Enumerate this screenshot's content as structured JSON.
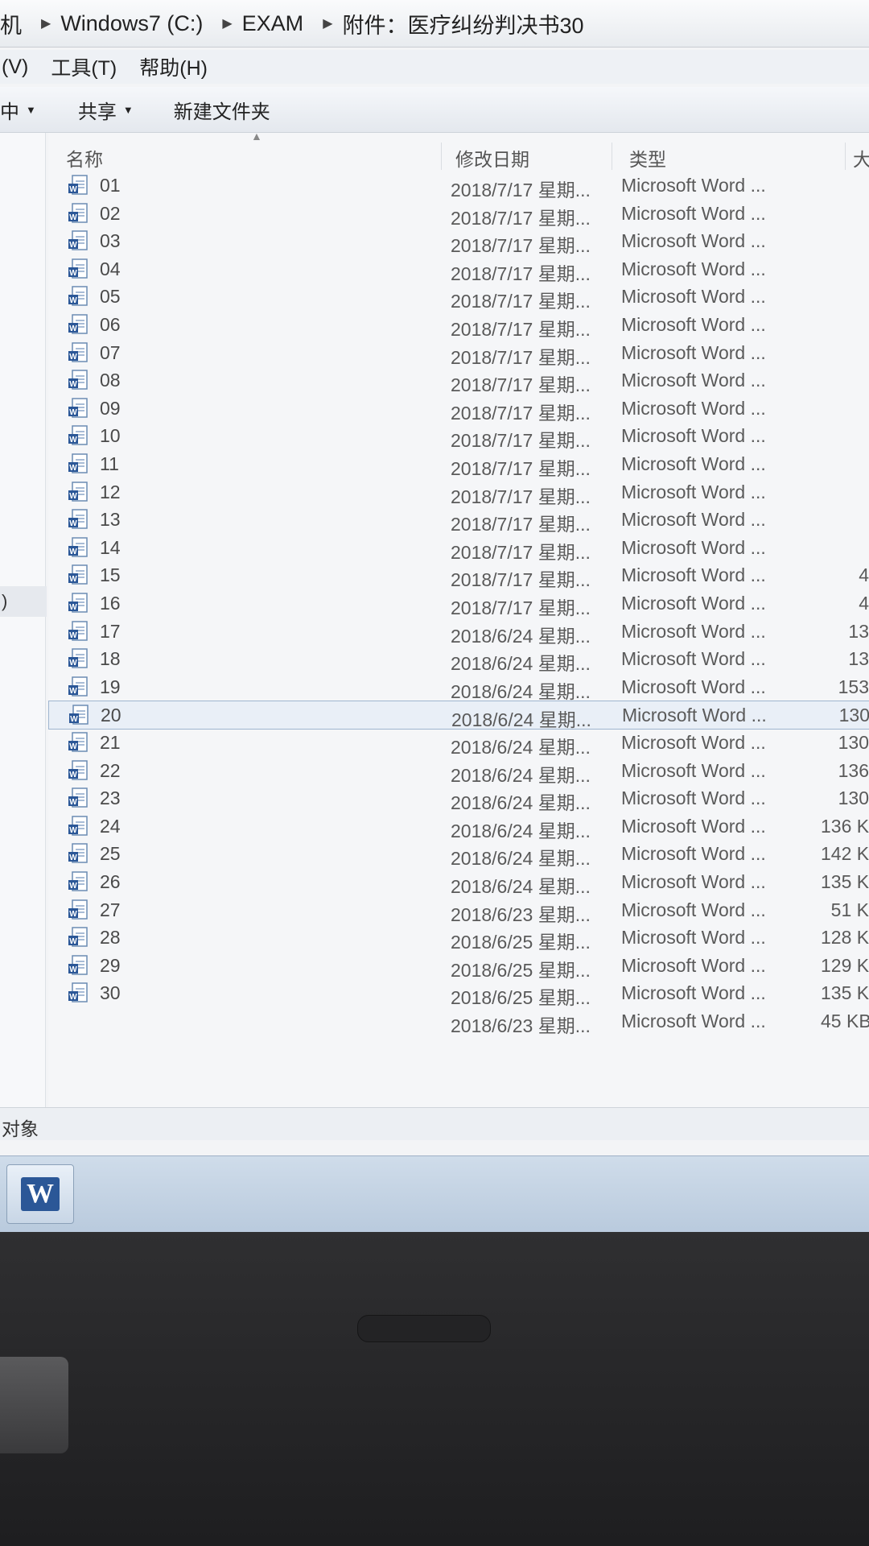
{
  "address_bar": {
    "crumbs": [
      "机",
      "Windows7 (C:)",
      "EXAM",
      "附件：医疗纠纷判决书30"
    ]
  },
  "menu_bar": {
    "items": [
      "(V)",
      "工具(T)",
      "帮助(H)"
    ]
  },
  "toolbar": {
    "include_label": "中",
    "share_label": "共享",
    "new_folder_label": "新建文件夹"
  },
  "nav_pane": {
    "selected_fragment": ")"
  },
  "file_list": {
    "columns": {
      "name": "名称",
      "date": "修改日期",
      "type": "类型",
      "size": "大"
    },
    "rows": [
      {
        "name": "01",
        "date": "2018/7/17 星期...",
        "type": "Microsoft Word ...",
        "size": ""
      },
      {
        "name": "02",
        "date": "2018/7/17 星期...",
        "type": "Microsoft Word ...",
        "size": ""
      },
      {
        "name": "03",
        "date": "2018/7/17 星期...",
        "type": "Microsoft Word ...",
        "size": ""
      },
      {
        "name": "04",
        "date": "2018/7/17 星期...",
        "type": "Microsoft Word ...",
        "size": ""
      },
      {
        "name": "05",
        "date": "2018/7/17 星期...",
        "type": "Microsoft Word ...",
        "size": ""
      },
      {
        "name": "06",
        "date": "2018/7/17 星期...",
        "type": "Microsoft Word ...",
        "size": ""
      },
      {
        "name": "07",
        "date": "2018/7/17 星期...",
        "type": "Microsoft Word ...",
        "size": ""
      },
      {
        "name": "08",
        "date": "2018/7/17 星期...",
        "type": "Microsoft Word ...",
        "size": ""
      },
      {
        "name": "09",
        "date": "2018/7/17 星期...",
        "type": "Microsoft Word ...",
        "size": ""
      },
      {
        "name": "10",
        "date": "2018/7/17 星期...",
        "type": "Microsoft Word ...",
        "size": ""
      },
      {
        "name": "11",
        "date": "2018/7/17 星期...",
        "type": "Microsoft Word ...",
        "size": ""
      },
      {
        "name": "12",
        "date": "2018/7/17 星期...",
        "type": "Microsoft Word ...",
        "size": ""
      },
      {
        "name": "13",
        "date": "2018/7/17 星期...",
        "type": "Microsoft Word ...",
        "size": ""
      },
      {
        "name": "14",
        "date": "2018/7/17 星期...",
        "type": "Microsoft Word ...",
        "size": ""
      },
      {
        "name": "15",
        "date": "2018/7/17 星期...",
        "type": "Microsoft Word ...",
        "size": "4"
      },
      {
        "name": "16",
        "date": "2018/7/17 星期...",
        "type": "Microsoft Word ...",
        "size": "4"
      },
      {
        "name": "17",
        "date": "2018/6/24 星期...",
        "type": "Microsoft Word ...",
        "size": "13"
      },
      {
        "name": "18",
        "date": "2018/6/24 星期...",
        "type": "Microsoft Word ...",
        "size": "13"
      },
      {
        "name": "19",
        "date": "2018/6/24 星期...",
        "type": "Microsoft Word ...",
        "size": "153"
      },
      {
        "name": "20",
        "date": "2018/6/24 星期...",
        "type": "Microsoft Word ...",
        "size": "130"
      },
      {
        "name": "21",
        "date": "2018/6/24 星期...",
        "type": "Microsoft Word ...",
        "size": "130"
      },
      {
        "name": "22",
        "date": "2018/6/24 星期...",
        "type": "Microsoft Word ...",
        "size": "136"
      },
      {
        "name": "23",
        "date": "2018/6/24 星期...",
        "type": "Microsoft Word ...",
        "size": "130"
      },
      {
        "name": "24",
        "date": "2018/6/24 星期...",
        "type": "Microsoft Word ...",
        "size": "136 K"
      },
      {
        "name": "25",
        "date": "2018/6/24 星期...",
        "type": "Microsoft Word ...",
        "size": "142 K"
      },
      {
        "name": "26",
        "date": "2018/6/24 星期...",
        "type": "Microsoft Word ...",
        "size": "135 K"
      },
      {
        "name": "27",
        "date": "2018/6/23 星期...",
        "type": "Microsoft Word ...",
        "size": "51 K"
      },
      {
        "name": "28",
        "date": "2018/6/25 星期...",
        "type": "Microsoft Word ...",
        "size": "128 KB"
      },
      {
        "name": "29",
        "date": "2018/6/25 星期...",
        "type": "Microsoft Word ...",
        "size": "129 KB"
      },
      {
        "name": "30",
        "date": "2018/6/25 星期...",
        "type": "Microsoft Word ...",
        "size": "135 KB"
      },
      {
        "name": "",
        "date": "2018/6/23 星期...",
        "type": "Microsoft Word ...",
        "size": "45 KB"
      }
    ],
    "selected_row_name": "20"
  },
  "status_bar": {
    "text": "对象"
  },
  "taskbar": {
    "word_icon_letter": "W"
  },
  "colors": {
    "selection_bg": "#e9eff7",
    "selection_border": "#9fb5cf",
    "word_blue": "#2b5797"
  }
}
